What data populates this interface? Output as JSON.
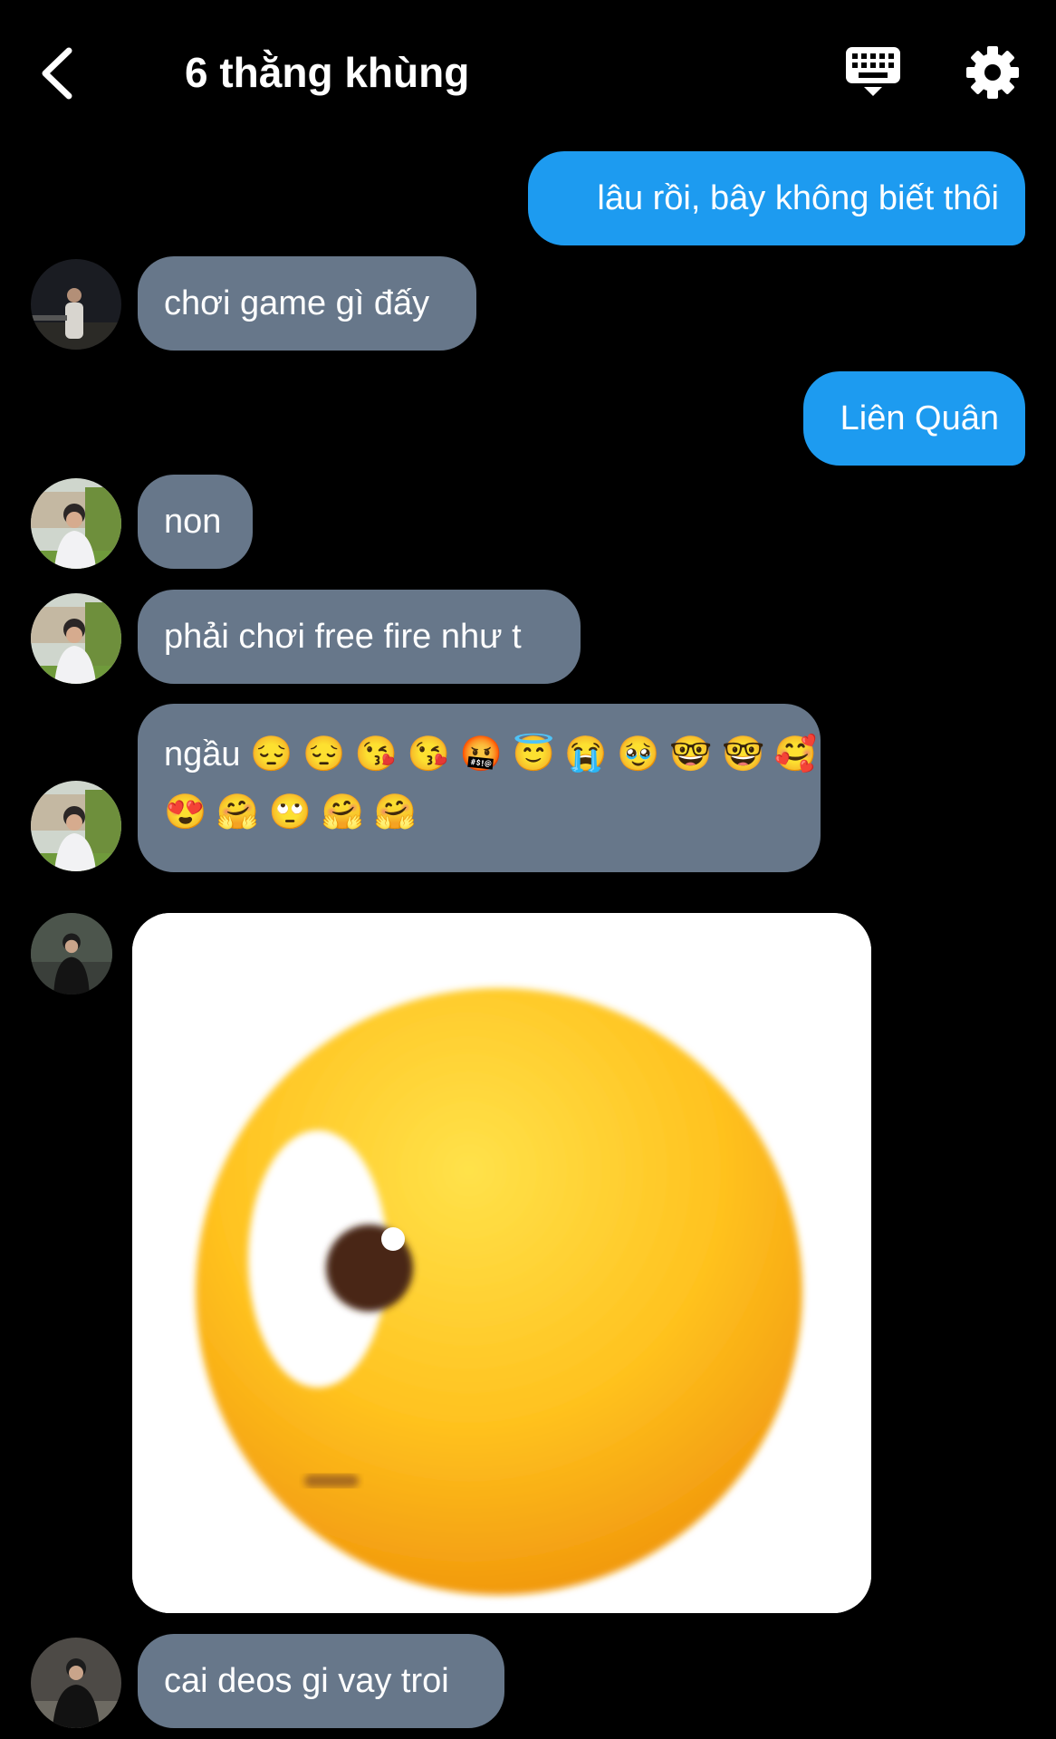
{
  "header": {
    "title": "6 thằng khùng",
    "back_icon": "chevron-left-icon",
    "keyboard_icon": "keyboard-icon",
    "settings_icon": "gear-icon"
  },
  "messages": [
    {
      "type": "text",
      "direction": "out",
      "text": "lâu rồi, bây không biết thôi"
    },
    {
      "type": "text",
      "direction": "in",
      "avatar": "avatar-night",
      "text": "chơi game gì đấy"
    },
    {
      "type": "text",
      "direction": "out",
      "text": "Liên Quân"
    },
    {
      "type": "text",
      "direction": "in",
      "avatar": "avatar-school",
      "text": "non"
    },
    {
      "type": "text",
      "direction": "in",
      "avatar": "avatar-school",
      "text": "phải chơi free fire như t"
    },
    {
      "type": "text",
      "direction": "in",
      "avatar": "avatar-school",
      "lines": [
        "ngầu 😔 😔 😘 😘 🤬 😇 😭 🥹 🤓 🤓 🥰",
        "😍 🤗 🙄 🤗 🤗"
      ]
    },
    {
      "type": "image",
      "direction": "in",
      "avatar": "avatar-dark",
      "image_desc": "eye-emoji-sticker"
    },
    {
      "type": "text",
      "direction": "in",
      "avatar": "avatar-dark",
      "text": "cai deos gi vay troi"
    }
  ],
  "colors": {
    "background": "#000000",
    "outgoing_bubble": "#1d9bf0",
    "incoming_bubble": "#67778a",
    "text": "#ffffff"
  }
}
